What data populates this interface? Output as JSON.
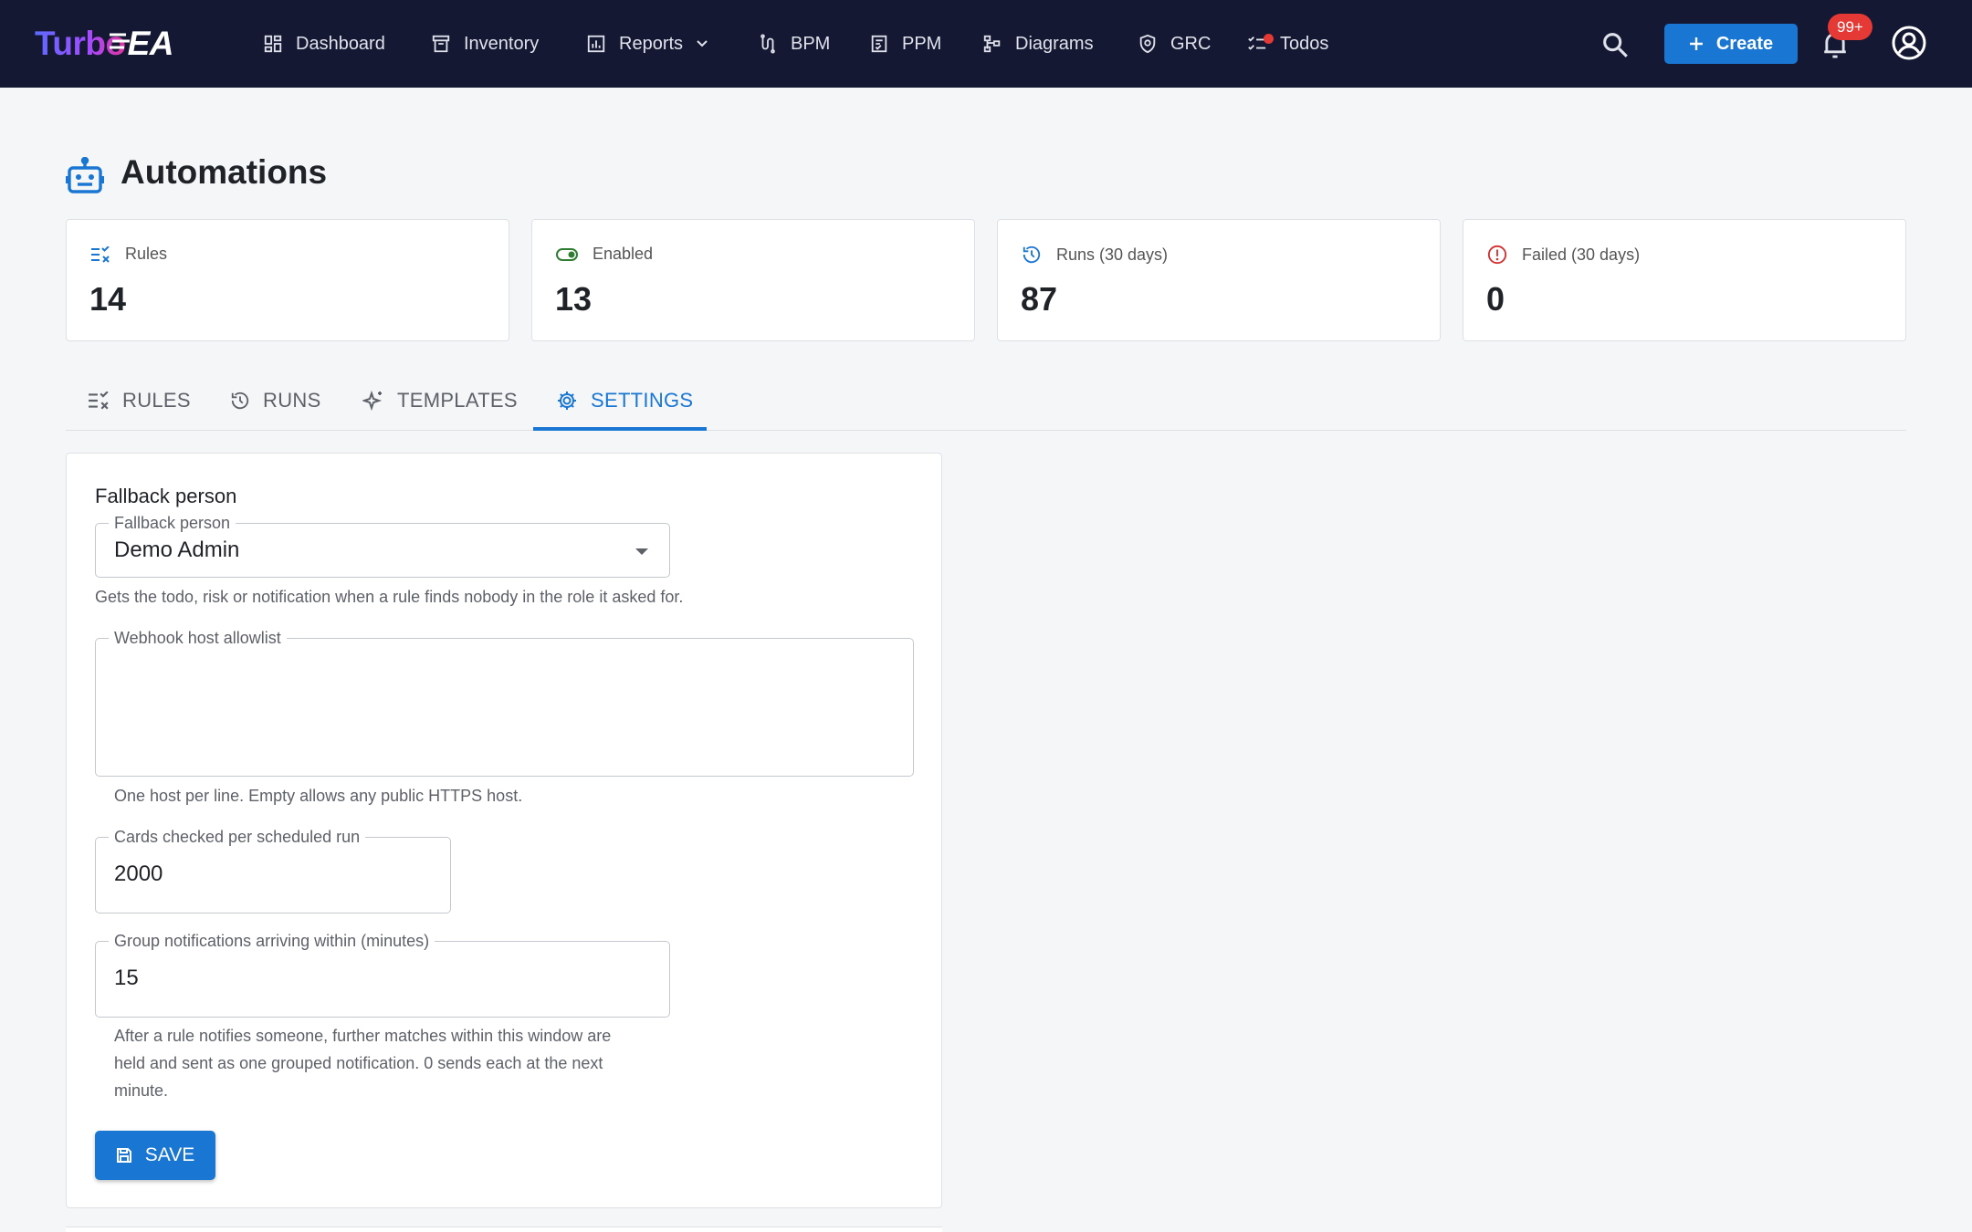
{
  "app": {
    "logo_part1": "Turbo",
    "logo_part2": "EA",
    "accent_color": "#1976d2",
    "topbar_color": "#151833"
  },
  "nav": {
    "items": [
      {
        "label": "Dashboard",
        "icon": "dashboard-icon"
      },
      {
        "label": "Inventory",
        "icon": "inventory-icon"
      },
      {
        "label": "Reports",
        "icon": "reports-icon"
      },
      {
        "label": "BPM",
        "icon": "bpm-icon"
      },
      {
        "label": "PPM",
        "icon": "ppm-icon"
      },
      {
        "label": "Diagrams",
        "icon": "diagrams-icon"
      },
      {
        "label": "GRC",
        "icon": "grc-icon"
      },
      {
        "label": "Todos",
        "icon": "todos-icon"
      }
    ],
    "create_label": "Create",
    "notification_badge": "99+"
  },
  "page": {
    "title": "Automations",
    "icon": "robot-icon"
  },
  "stats": [
    {
      "label": "Rules",
      "value": "14",
      "icon": "rules-icon",
      "color": "#1976d2"
    },
    {
      "label": "Enabled",
      "value": "13",
      "icon": "toggle-on-icon",
      "color": "#2e7d32"
    },
    {
      "label": "Runs (30 days)",
      "value": "87",
      "icon": "history-icon",
      "color": "#1976d2"
    },
    {
      "label": "Failed (30 days)",
      "value": "0",
      "icon": "error-icon",
      "color": "#d32f2f"
    }
  ],
  "tabs": [
    {
      "label": "RULES",
      "icon": "rules-icon"
    },
    {
      "label": "RUNS",
      "icon": "history-icon"
    },
    {
      "label": "TEMPLATES",
      "icon": "sparkle-icon"
    },
    {
      "label": "SETTINGS",
      "icon": "gear-icon",
      "active": true
    }
  ],
  "settings": {
    "section_title": "Fallback person",
    "fallback_label": "Fallback person",
    "fallback_value": "Demo Admin",
    "fallback_helper": "Gets the todo, risk or notification when a rule finds nobody in the role it asked for.",
    "webhook_label": "Webhook host allowlist",
    "webhook_value": "",
    "webhook_helper": "One host per line. Empty allows any public HTTPS host.",
    "cards_label": "Cards checked per scheduled run",
    "cards_value": "2000",
    "group_label": "Group notifications arriving within (minutes)",
    "group_value": "15",
    "group_helper_1": "After a rule notifies someone, further matches within this window are",
    "group_helper_2": "held and sent as one grouped notification. 0 sends each at the next",
    "group_helper_3": "minute.",
    "save_label": "SAVE"
  }
}
